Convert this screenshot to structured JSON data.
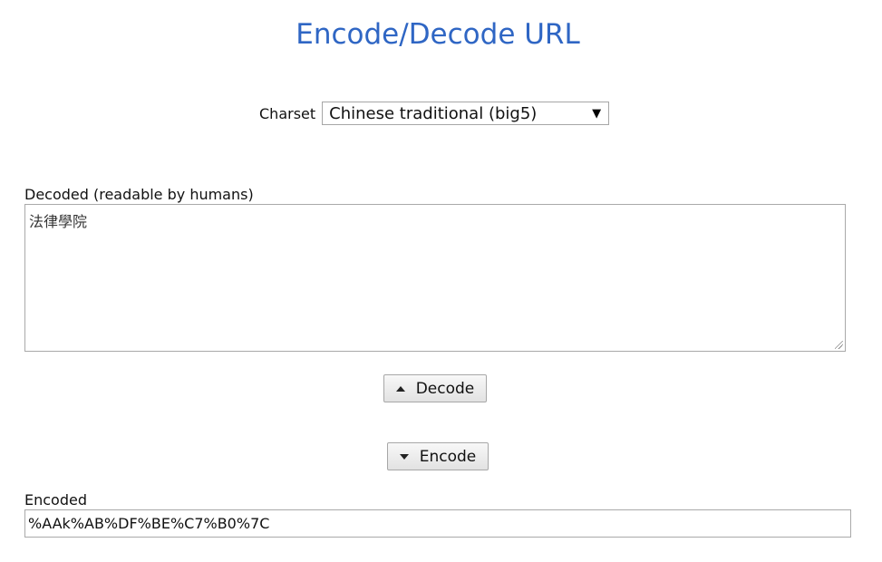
{
  "page": {
    "title": "Encode/Decode URL",
    "title_color": "#2f66c4"
  },
  "charset": {
    "label": "Charset",
    "selected": "Chinese traditional (big5)"
  },
  "decoded": {
    "label": "Decoded (readable by humans)",
    "value": "法律學院"
  },
  "buttons": {
    "decode_label": "Decode",
    "decode_icon": "triangle-up-icon",
    "encode_label": "Encode",
    "encode_icon": "triangle-down-icon"
  },
  "encoded": {
    "label": "Encoded",
    "value": "%AAk%AB%DF%BE%C7%B0%7C"
  }
}
